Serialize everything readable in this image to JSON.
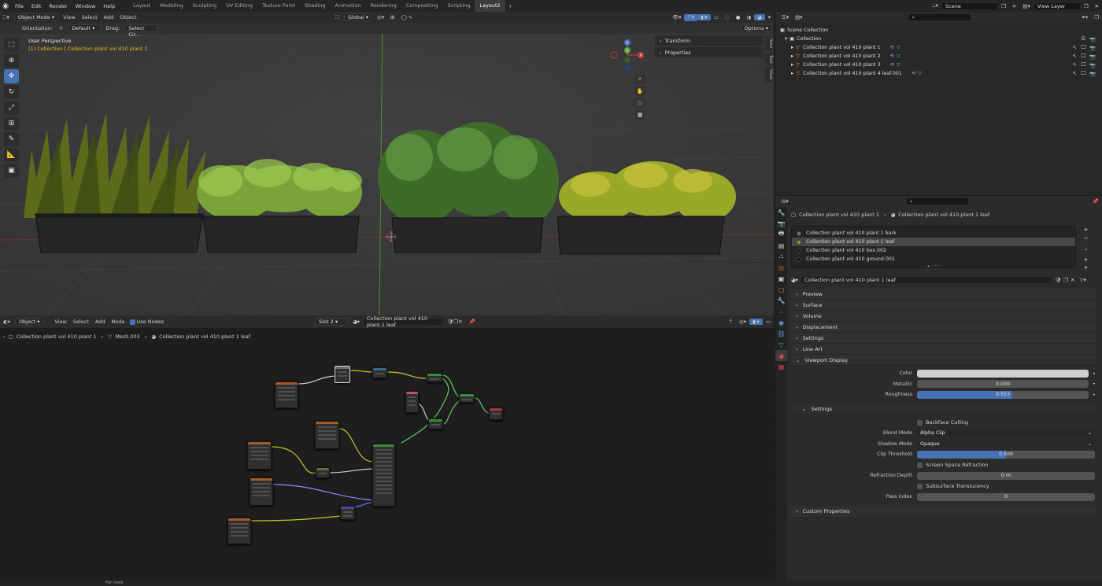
{
  "topbar": {
    "menus": [
      "File",
      "Edit",
      "Render",
      "Window",
      "Help"
    ],
    "workspaces": [
      "Layout",
      "Modeling",
      "Sculpting",
      "UV Editing",
      "Texture Paint",
      "Shading",
      "Animation",
      "Rendering",
      "Compositing",
      "Scripting",
      "Layout2"
    ],
    "active_workspace": "Layout2",
    "scene": "Scene",
    "view_layer": "View Layer"
  },
  "viewport": {
    "mode": "Object Mode",
    "menus": [
      "View",
      "Select",
      "Add",
      "Object"
    ],
    "transform_orientation": "Global",
    "orientation_label": "Orientation:",
    "orientation_value": "Default",
    "drag_label": "Drag:",
    "drag_value": "Select Cir...",
    "options": "Options",
    "overlay_title": "User Perspective",
    "overlay_sub": "(1) Collection | Collection plant vol 410 plant 1",
    "npanel": [
      "Transform",
      "Properties"
    ],
    "side_tabs": [
      "Item",
      "Tool",
      "View"
    ],
    "gizmo_axes": [
      "Z",
      "Y",
      "X"
    ]
  },
  "outliner": {
    "root": "Scene Collection",
    "collection": "Collection",
    "items": [
      "Collection plant vol 410 plant 1",
      "Collection plant vol 410 plant 2",
      "Collection plant vol 410 plant 3",
      "Collection plant vol 410 plant 4 leaf.001"
    ]
  },
  "properties": {
    "breadcrumb_object": "Collection plant vol 410 plant 1",
    "breadcrumb_material": "Collection plant vol 410 plant 1 leaf",
    "slots": [
      {
        "name": "Collection plant vol 410 plant 1 bark",
        "color": "#4c8a3a"
      },
      {
        "name": "Collection plant vol 410 plant 1 leaf",
        "color": "#8aa42c"
      },
      {
        "name": "Collection plant vol 410 box.002",
        "color": "#1a1a1a"
      },
      {
        "name": "Collection plant vol 410 ground.001",
        "color": "#111111"
      }
    ],
    "selected_slot": 1,
    "material_name": "Collection plant vol 410 plant 1 leaf",
    "sections": [
      "Preview",
      "Surface",
      "Volume",
      "Displacement",
      "Settings",
      "Line Art",
      "Viewport Display"
    ],
    "viewport_display": {
      "color_label": "Color",
      "metallic_label": "Metallic",
      "metallic_value": "0.000",
      "roughness_label": "Roughness",
      "roughness_value": "0.553",
      "roughness_fraction": 0.553
    },
    "settings_header": "Settings",
    "settings": {
      "backface_culling": "Backface Culling",
      "blend_mode_label": "Blend Mode",
      "blend_mode": "Alpha Clip",
      "shadow_mode_label": "Shadow Mode",
      "shadow_mode": "Opaque",
      "clip_threshold_label": "Clip Threshold",
      "clip_threshold": "0.500",
      "clip_fraction": 0.5,
      "ssr": "Screen Space Refraction",
      "refraction_depth_label": "Refraction Depth",
      "refraction_depth": "0 m",
      "subsurface": "Subsurface Translucency",
      "pass_index_label": "Pass Index",
      "pass_index": "0"
    },
    "custom_properties": "Custom Properties"
  },
  "node_editor": {
    "object": "Object",
    "menus": [
      "View",
      "Select",
      "Add",
      "Node"
    ],
    "use_nodes": "Use Nodes",
    "slot": "Slot 2",
    "material": "Collection plant vol 410 plant 1 leaf",
    "breadcrumb": [
      "Collection plant vol 410 plant 1",
      "Mesh.003",
      "Collection plant vol 410 plant 1 leaf"
    ]
  },
  "status": {
    "pan_view": "Pan View"
  }
}
